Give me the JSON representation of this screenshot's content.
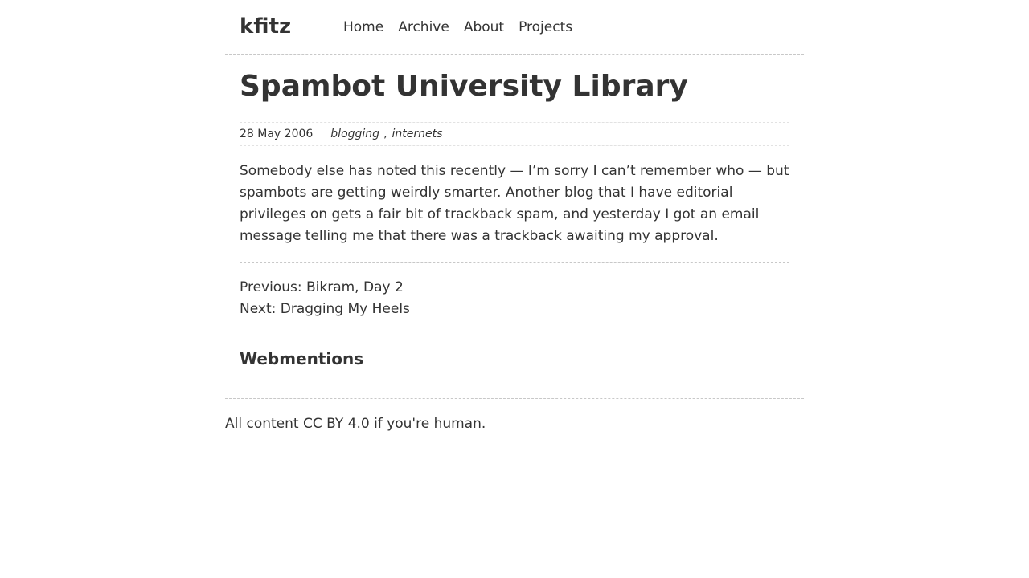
{
  "header": {
    "site_title": "kfitz",
    "nav": [
      {
        "label": "Home"
      },
      {
        "label": "Archive"
      },
      {
        "label": "About"
      },
      {
        "label": "Projects"
      }
    ]
  },
  "post": {
    "title": "Spambot University Library",
    "date": "28 May 2006",
    "tags": [
      "blogging",
      "internets"
    ],
    "tag_separator": ",",
    "body": "Somebody else has noted this recently — I’m sorry I can’t remember who — but spambots are getting weirdly smarter. Another blog that I have editorial privileges on gets a fair bit of trackback spam, and yesterday I got an email message telling me that there was a trackback awaiting my approval."
  },
  "post_nav": {
    "previous_prefix": "Previous: ",
    "previous_title": "Bikram, Day 2",
    "next_prefix": "Next: ",
    "next_title": "Dragging My Heels"
  },
  "webmentions": {
    "heading": "Webmentions"
  },
  "footer": {
    "text": "All content CC BY 4.0 if you're human."
  },
  "colors": {
    "text": "#333333",
    "background": "#ffffff",
    "rule": "#c8c8c8"
  }
}
